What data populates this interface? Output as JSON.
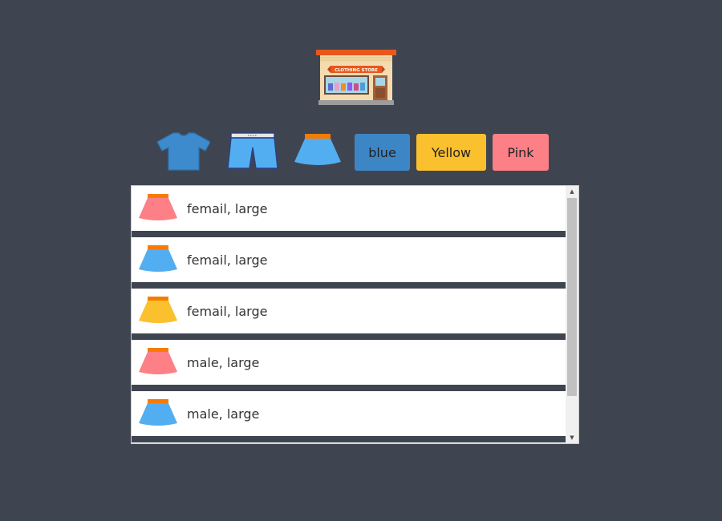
{
  "store": {
    "sign_text": "CLOTHING STORE"
  },
  "toolbar": {
    "icons": [
      {
        "name": "tshirt-icon",
        "color": "#3d8bcd"
      },
      {
        "name": "shorts-icon",
        "color": "#52aef0"
      },
      {
        "name": "skirt-icon",
        "color": "#52aef0"
      }
    ],
    "buttons": [
      {
        "label": "blue",
        "color": "#3d86c6"
      },
      {
        "label": "Yellow",
        "color": "#fbc02d"
      },
      {
        "label": "Pink",
        "color": "#fd8086"
      }
    ]
  },
  "list": {
    "items": [
      {
        "label": "femail, large",
        "color": "#fd8086",
        "icon": "skirt-icon"
      },
      {
        "label": "femail, large",
        "color": "#52aef0",
        "icon": "skirt-icon"
      },
      {
        "label": "femail, large",
        "color": "#fbc02d",
        "icon": "skirt-icon"
      },
      {
        "label": "male, large",
        "color": "#fd8086",
        "icon": "skirt-icon"
      },
      {
        "label": "male, large",
        "color": "#52aef0",
        "icon": "skirt-icon"
      }
    ]
  },
  "scrollbar": {
    "up_arrow": "▲",
    "down_arrow": "▼"
  }
}
